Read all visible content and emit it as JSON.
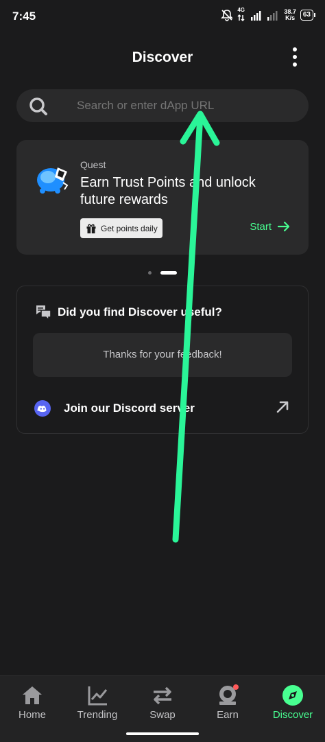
{
  "status": {
    "time": "7:45",
    "network_tag": "4G",
    "net_speed": "38.7",
    "net_speed_unit": "K/s",
    "battery": "63"
  },
  "header": {
    "title": "Discover"
  },
  "search": {
    "placeholder": "Search or enter dApp URL"
  },
  "quest": {
    "label": "Quest",
    "title": "Earn Trust Points and unlock future rewards",
    "pill": "Get points daily",
    "cta": "Start"
  },
  "carousel": {
    "pages": 2,
    "active": 2
  },
  "feedback": {
    "question": "Did you find Discover useful?",
    "thanks": "Thanks for your feedback!",
    "discord": "Join our Discord server"
  },
  "nav": [
    {
      "label": "Home",
      "icon": "home-icon"
    },
    {
      "label": "Trending",
      "icon": "trending-icon"
    },
    {
      "label": "Swap",
      "icon": "swap-icon"
    },
    {
      "label": "Earn",
      "icon": "earn-icon"
    },
    {
      "label": "Discover",
      "icon": "discover-icon"
    }
  ],
  "colors": {
    "background": "#1b1b1c",
    "card": "#2a2a2b",
    "accent": "#48ff91",
    "notification": "#ff5a5a",
    "discord": "#5865f2"
  }
}
